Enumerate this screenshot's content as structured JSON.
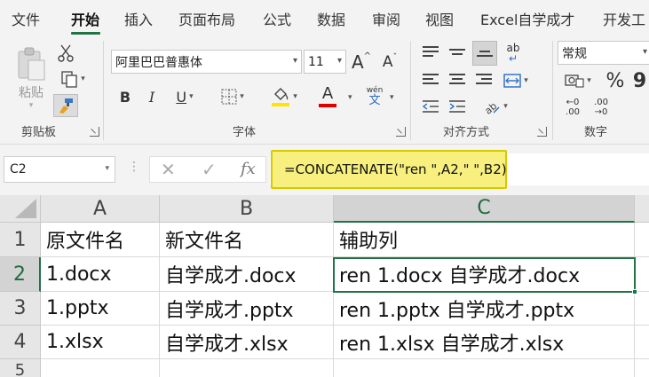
{
  "menu": {
    "tabs": [
      "文件",
      "开始",
      "插入",
      "页面布局",
      "公式",
      "数据",
      "审阅",
      "视图",
      "Excel自学成才",
      "开发工"
    ],
    "active": "开始"
  },
  "ribbon": {
    "clipboard": {
      "paste_label": "粘贴",
      "group_label": "剪贴板"
    },
    "font": {
      "font_name": "阿里巴巴普惠体",
      "font_size": "11",
      "grow_label": "A",
      "shrink_label": "A",
      "bold": "B",
      "italic": "I",
      "underline": "U",
      "font_color_label": "A",
      "phonetic_top": "wén",
      "phonetic_bottom": "文",
      "group_label": "字体"
    },
    "alignment": {
      "wrap_label": "ab",
      "group_label": "对齐方式"
    },
    "number": {
      "format": "常规",
      "percent": "%",
      "comma": "9",
      "inc_decimal": "←0 .00",
      "dec_decimal": ".00 →0",
      "group_label": "数字"
    },
    "colors": {
      "fill": "#ffe600",
      "font": "#e00000",
      "accent": "#217346"
    }
  },
  "formula_bar": {
    "name_box": "C2",
    "cancel_icon": "✕",
    "enter_icon": "✓",
    "fx_label": "fx",
    "formula": "=CONCATENATE(\"ren \",A2,\" \",B2)"
  },
  "sheet": {
    "columns": [
      "A",
      "B",
      "C"
    ],
    "rows": [
      "1",
      "2",
      "3",
      "4",
      "5"
    ],
    "cells": [
      [
        "原文件名",
        "新文件名",
        "辅助列"
      ],
      [
        "1.docx",
        "自学成才.docx",
        "ren 1.docx 自学成才.docx"
      ],
      [
        "1.pptx",
        "自学成才.pptx",
        "ren 1.pptx 自学成才.pptx"
      ],
      [
        "1.xlsx",
        "自学成才.xlsx",
        "ren 1.xlsx 自学成才.xlsx"
      ],
      [
        "",
        "",
        ""
      ]
    ],
    "active_cell": "C2"
  }
}
